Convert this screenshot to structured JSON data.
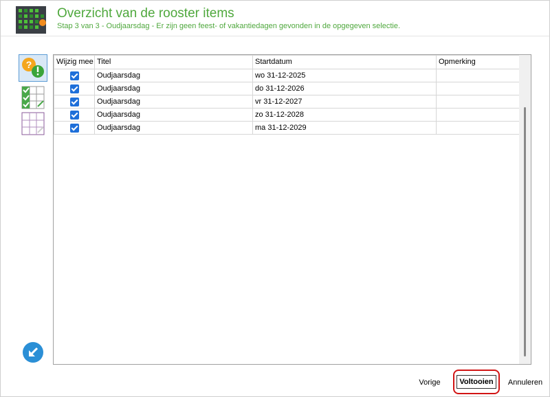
{
  "header": {
    "title": "Overzicht van de rooster items",
    "subtitle": "Stap 3 van 3 - Oudjaarsdag - Er zijn geen feest- of vakantiedagen gevonden in de opgegeven selectie."
  },
  "sidebar": {
    "items": [
      {
        "name": "overview-step",
        "icon": "question-exclamation-icon",
        "active": true
      },
      {
        "name": "selection-step",
        "icon": "checked-grid-icon",
        "active": false
      },
      {
        "name": "empty-grid-step",
        "icon": "empty-grid-icon",
        "active": false
      },
      {
        "name": "back",
        "icon": "back-arrow-icon",
        "active": false
      }
    ]
  },
  "grid": {
    "columns": [
      "Wijzig mee",
      "Titel",
      "Startdatum",
      "Opmerking"
    ],
    "rows": [
      {
        "checked": true,
        "titel": "Oudjaarsdag",
        "startdatum": "wo 31-12-2025",
        "opmerking": ""
      },
      {
        "checked": true,
        "titel": "Oudjaarsdag",
        "startdatum": "do 31-12-2026",
        "opmerking": ""
      },
      {
        "checked": true,
        "titel": "Oudjaarsdag",
        "startdatum": "vr 31-12-2027",
        "opmerking": ""
      },
      {
        "checked": true,
        "titel": "Oudjaarsdag",
        "startdatum": "zo 31-12-2028",
        "opmerking": ""
      },
      {
        "checked": true,
        "titel": "Oudjaarsdag",
        "startdatum": "ma 31-12-2029",
        "opmerking": ""
      }
    ]
  },
  "footer": {
    "prev_label": "Vorige",
    "finish_label": "Voltooien",
    "cancel_label": "Annuleren"
  },
  "colors": {
    "accent_green": "#4fa83d",
    "checkbox_blue": "#1e6fd9",
    "highlight_red": "#d11414"
  }
}
